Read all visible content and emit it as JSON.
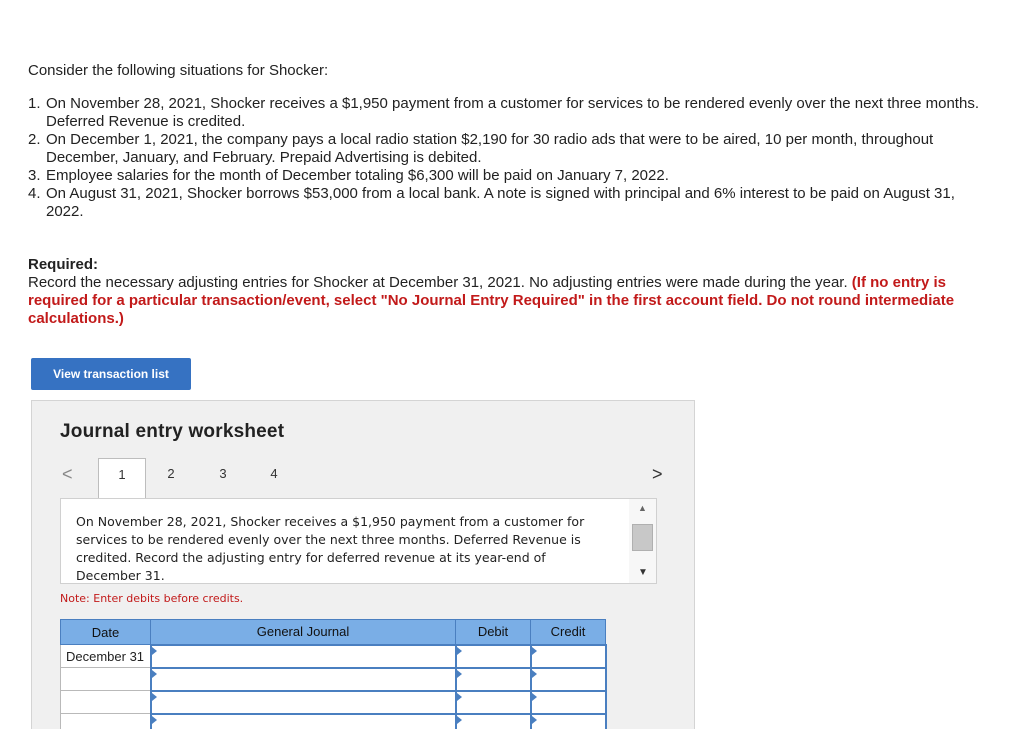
{
  "intro": "Consider the following situations for Shocker:",
  "situations": [
    {
      "num": "1.",
      "text": "On November 28, 2021, Shocker receives a $1,950 payment from a customer for services to be rendered evenly over the next three months. Deferred Revenue is credited."
    },
    {
      "num": "2.",
      "text": "On December 1, 2021, the company pays a local radio station $2,190 for 30 radio ads that were to be aired, 10 per month, throughout December, January, and February. Prepaid Advertising is debited."
    },
    {
      "num": "3.",
      "text": "Employee salaries for the month of December totaling $6,300 will be paid on January 7, 2022."
    },
    {
      "num": "4.",
      "text": "On August 31, 2021, Shocker borrows $53,000 from a local bank. A note is signed with principal and 6% interest to be paid on August 31, 2022."
    }
  ],
  "required": {
    "heading": "Required:",
    "body": "Record the necessary adjusting entries for Shocker at December 31, 2021. No adjusting entries were made during the year. ",
    "instruction": "(If no entry is required for a particular transaction/event, select \"No Journal Entry Required\" in the first account field. Do not round intermediate calculations.)"
  },
  "view_button": "View transaction list",
  "worksheet": {
    "title": "Journal entry worksheet",
    "prev_icon": "<",
    "next_icon": ">",
    "tabs": [
      "1",
      "2",
      "3",
      "4"
    ],
    "description": "On November 28, 2021, Shocker receives a $1,950 payment from a customer for services to be rendered evenly over the next three months. Deferred Revenue is credited. Record the adjusting entry for deferred revenue at its year-end of December 31.",
    "note": "Note: Enter debits before credits.",
    "table": {
      "headers": [
        "Date",
        "General Journal",
        "Debit",
        "Credit"
      ],
      "rows": [
        {
          "date": "December 31",
          "account": "",
          "debit": "",
          "credit": ""
        },
        {
          "date": "",
          "account": "",
          "debit": "",
          "credit": ""
        },
        {
          "date": "",
          "account": "",
          "debit": "",
          "credit": ""
        },
        {
          "date": "",
          "account": "",
          "debit": "",
          "credit": ""
        }
      ]
    }
  },
  "colors": {
    "accent": "#3672c2",
    "table_header": "#7aaee6",
    "instruction_red": "#c21a1a"
  }
}
